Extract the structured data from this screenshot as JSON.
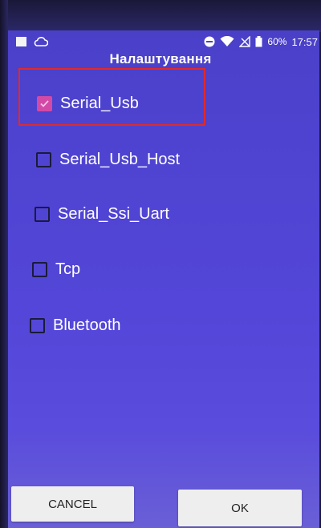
{
  "status_bar": {
    "battery_percent": "60%",
    "time": "17:57"
  },
  "dialog": {
    "title": "Налаштування",
    "options": [
      {
        "label": "Serial_Usb",
        "checked": true
      },
      {
        "label": "Serial_Usb_Host",
        "checked": false
      },
      {
        "label": "Serial_Ssi_Uart",
        "checked": false
      },
      {
        "label": "Tcp",
        "checked": false
      },
      {
        "label": "Bluetooth",
        "checked": false
      }
    ],
    "cancel_label": "CANCEL",
    "ok_label": "OK"
  },
  "colors": {
    "dialog_background": "#4e43d0",
    "checkbox_checked": "#d24aa6",
    "highlight_border": "#e02a2a"
  }
}
